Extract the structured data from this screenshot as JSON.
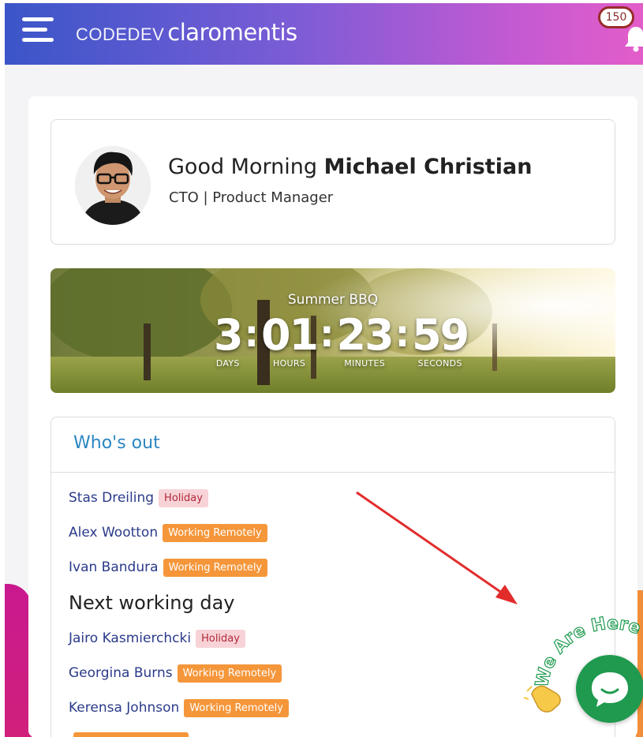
{
  "header": {
    "brand_sub": "CODEDEV",
    "brand_main": "claromentis",
    "notification_count": "150",
    "colors": {
      "gradient_start": "#3a56c8",
      "gradient_end": "#e35dc9"
    }
  },
  "profile": {
    "greeting": "Good Morning",
    "name": "Michael Christian",
    "role": "CTO | Product Manager"
  },
  "event": {
    "title": "Summer BBQ",
    "days": "3",
    "hours": "01",
    "minutes": "23",
    "seconds": "59",
    "days_label": "DAYS",
    "hours_label": "HOURS",
    "minutes_label": "MINUTES",
    "seconds_label": "SECONDS"
  },
  "whos_out": {
    "title": "Who's out",
    "today": [
      {
        "name": "Stas Dreiling",
        "status": "Holiday"
      },
      {
        "name": "Alex Wootton",
        "status": "Working Remotely"
      },
      {
        "name": "Ivan Bandura",
        "status": "Working Remotely"
      }
    ],
    "next_heading": "Next working day",
    "next": [
      {
        "name": "Jairo Kasmierchcki",
        "status": "Holiday"
      },
      {
        "name": "Georgina Burns",
        "status": "Working Remotely"
      },
      {
        "name": "Kerensa Johnson",
        "status": "Working Remotely"
      }
    ]
  },
  "chat": {
    "banner_text": "We Are Here"
  }
}
